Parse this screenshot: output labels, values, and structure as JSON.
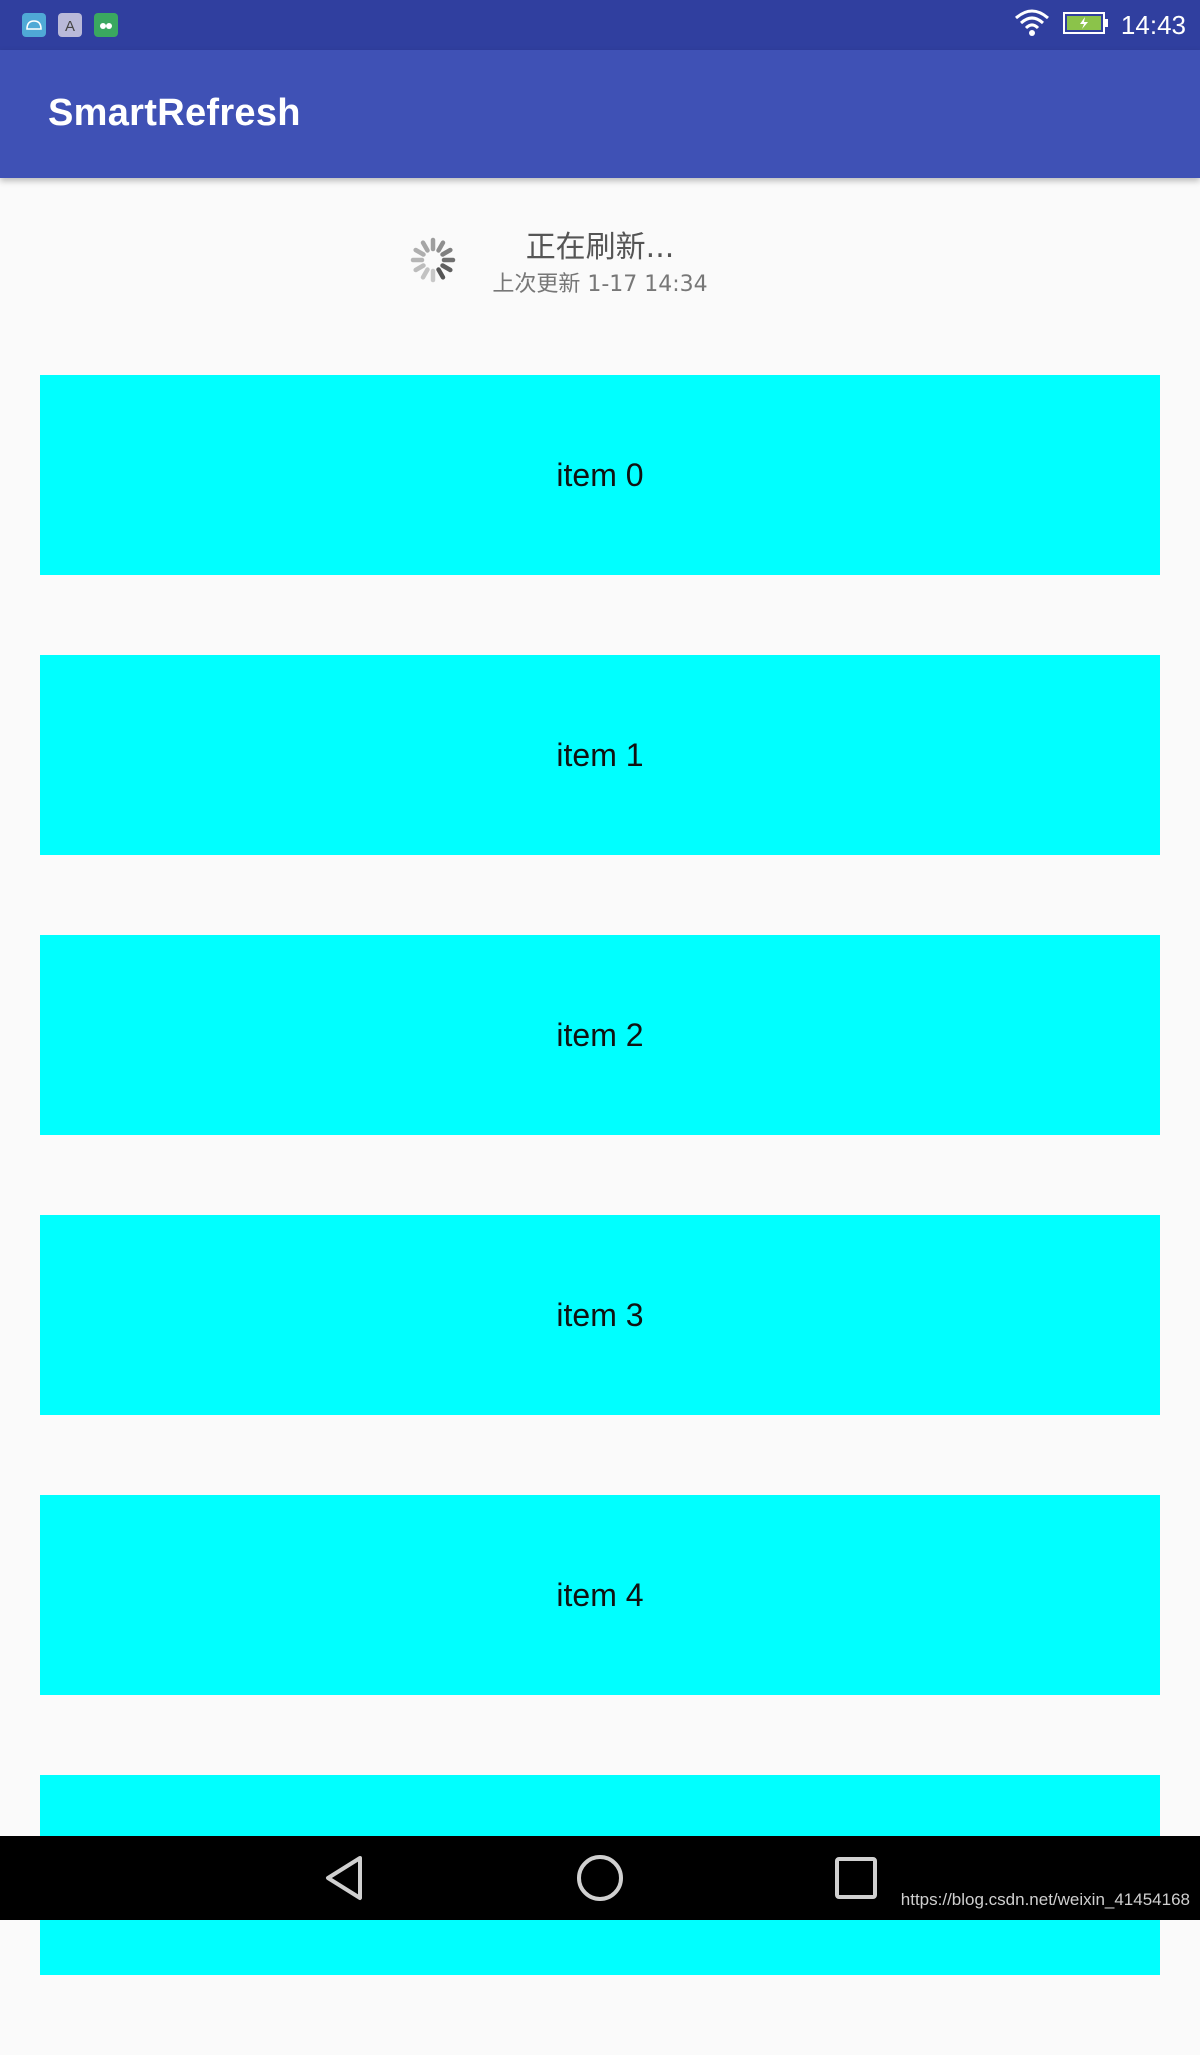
{
  "status_bar": {
    "time": "14:43",
    "notification_icons": [
      "android-icon",
      "font-a-icon",
      "green-app-icon"
    ],
    "wifi": "wifi-icon",
    "battery": "battery-charging-icon",
    "battery_color": "#8bc34a"
  },
  "app_bar": {
    "title": "SmartRefresh",
    "color": "#3f51b5"
  },
  "refresh_header": {
    "title": "正在刷新...",
    "last_update": "上次更新 1-17 14:34"
  },
  "list": {
    "item_color": "#00ffff",
    "items": [
      {
        "label": "item 0"
      },
      {
        "label": "item 1"
      },
      {
        "label": "item 2"
      },
      {
        "label": "item 3"
      },
      {
        "label": "item 4"
      },
      {
        "label": ""
      }
    ]
  },
  "nav_bar": {
    "back": "back-triangle-icon",
    "home": "home-circle-icon",
    "recents": "recents-square-icon"
  },
  "watermark": "https://blog.csdn.net/weixin_41454168"
}
